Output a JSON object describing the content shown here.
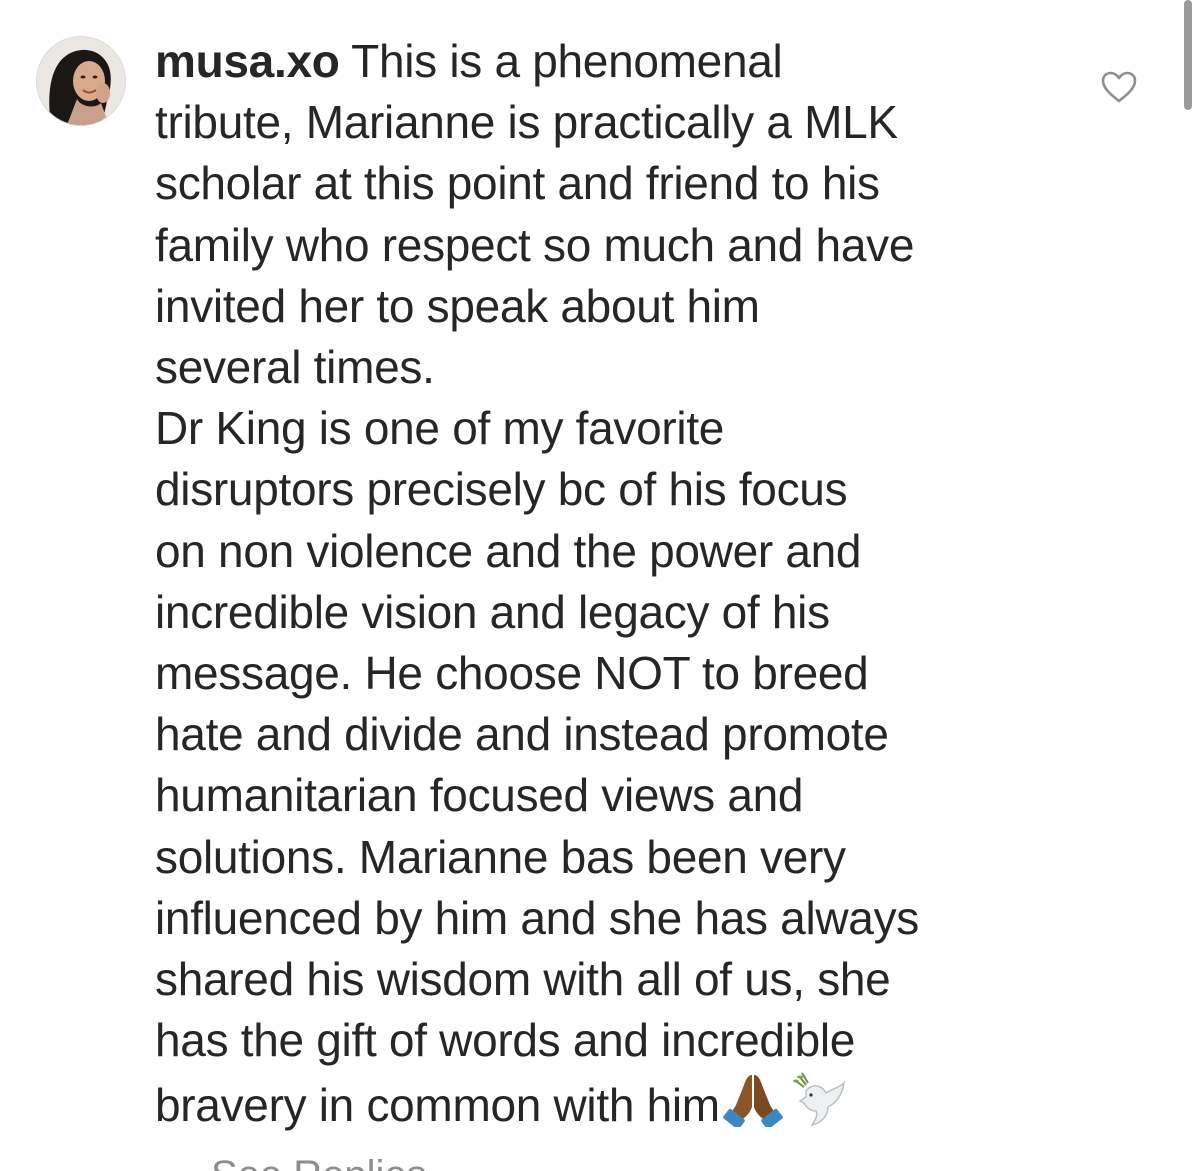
{
  "comment": {
    "username": "musa.xo",
    "lines": [
      " This is a phenomenal",
      "tribute, Marianne is practically a MLK",
      "scholar at this point and friend to his",
      "family who respect so much and have",
      "invited her to speak about him",
      "several times.",
      "Dr King is one of my favorite",
      "disruptors precisely bc of his focus",
      "on non violence and the power and",
      "incredible vision and legacy of his",
      "message. He choose NOT to breed",
      "hate and divide and instead promote",
      "humanitarian focused views and",
      "solutions. Marianne bas been very",
      "influenced by him and she has always",
      "shared his wisdom with all of us, she",
      "has the gift of words and incredible",
      "bravery in common with him"
    ],
    "emojis": [
      "folded-hands-icon",
      "dove-icon"
    ]
  },
  "replies_link": "See Replies",
  "colors": {
    "text": "#262626",
    "secondary": "#8e8e8e",
    "emoji_skin": "#8d5524",
    "emoji_sleeve": "#3b88c3"
  }
}
